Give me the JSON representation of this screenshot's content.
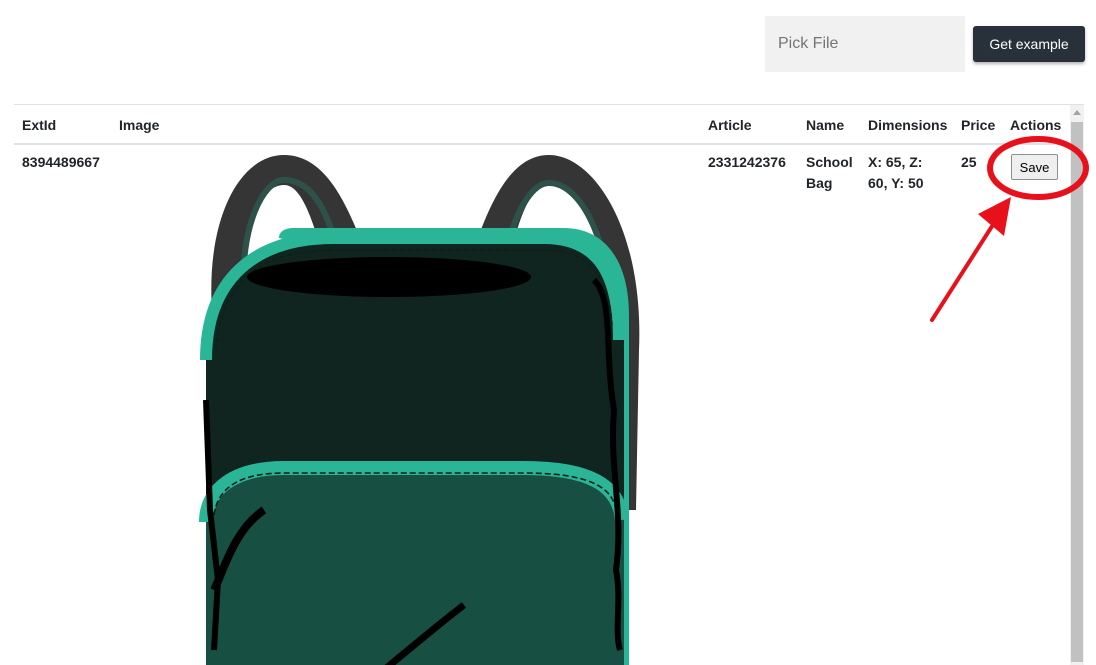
{
  "toolbar": {
    "file_placeholder": "Pick File",
    "get_example_label": "Get example"
  },
  "table": {
    "columns": [
      "ExtId",
      "Image",
      "Article",
      "Name",
      "Dimensions",
      "Price",
      "Actions"
    ],
    "rows": [
      {
        "ext_id": "8394489667",
        "image_icon": "school-bag-image",
        "article": "2331242376",
        "name_line1": "School",
        "name_line2": "Bag",
        "dimensions_line1": "X: 65, Z:",
        "dimensions_line2": "60, Y: 50",
        "price": "25",
        "action_label": "Save"
      }
    ]
  },
  "colors": {
    "primary_button": "#283039",
    "annotation_red": "#e8101a",
    "bag_dark": "#10251f",
    "bag_teal": "#2bb597"
  }
}
